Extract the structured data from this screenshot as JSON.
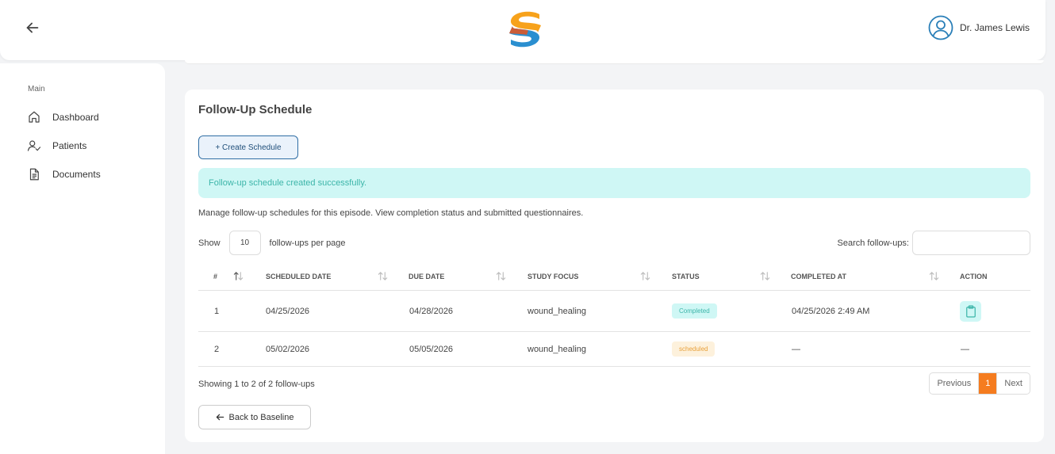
{
  "header": {
    "user_name": "Dr. James Lewis"
  },
  "sidebar": {
    "section": "Main",
    "items": [
      {
        "label": "Dashboard",
        "icon": "home-icon"
      },
      {
        "label": "Patients",
        "icon": "user-check-icon"
      },
      {
        "label": "Documents",
        "icon": "document-icon"
      }
    ]
  },
  "main": {
    "title": "Follow-Up Schedule",
    "create_button": "+ Create Schedule",
    "alert": "Follow-up schedule created successfully.",
    "description": "Manage follow-up schedules for this episode. View completion status and submitted questionnaires.",
    "show_label": "Show",
    "page_size": "10",
    "per_page_label": "follow-ups per page",
    "search_label": "Search follow-ups:",
    "search_value": "",
    "columns": [
      "#",
      "SCHEDULED DATE",
      "DUE DATE",
      "STUDY FOCUS",
      "STATUS",
      "COMPLETED AT",
      "ACTION"
    ],
    "rows": [
      {
        "num": "1",
        "scheduled": "04/25/2026",
        "due": "04/28/2026",
        "focus": "wound_healing",
        "status": "Completed",
        "completed_at": "04/25/2026 2:49 AM",
        "action": ""
      },
      {
        "num": "2",
        "scheduled": "05/02/2026",
        "due": "05/05/2026",
        "focus": "wound_healing",
        "status": "scheduled",
        "completed_at": "—",
        "action": "—"
      }
    ],
    "showing": "Showing 1 to 2 of 2 follow-ups",
    "pager": {
      "prev": "Previous",
      "page": "1",
      "next": "Next"
    },
    "back_button": "Back to Baseline"
  },
  "colors": {
    "accent_orange": "#f57c1f",
    "teal_bg": "#cff7f5",
    "teal_text": "#3cb5a9",
    "primary_blue": "#2e6da4"
  }
}
